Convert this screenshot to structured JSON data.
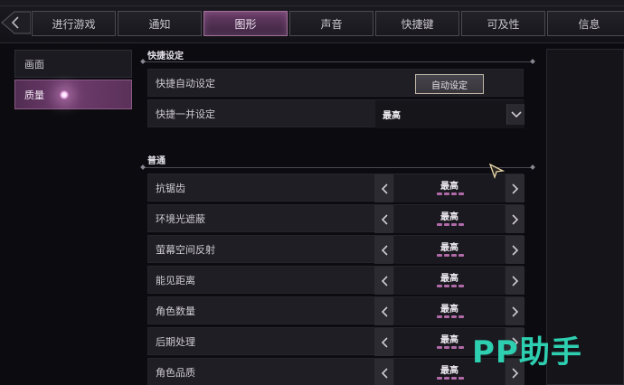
{
  "tabs": [
    {
      "label": "进行游戏",
      "active": false
    },
    {
      "label": "通知",
      "active": false
    },
    {
      "label": "图形",
      "active": true
    },
    {
      "label": "声音",
      "active": false
    },
    {
      "label": "快捷键",
      "active": false
    },
    {
      "label": "可及性",
      "active": false
    },
    {
      "label": "信息",
      "active": false
    }
  ],
  "sidebar": {
    "items": [
      {
        "label": "画面",
        "active": false
      },
      {
        "label": "质量",
        "active": true
      }
    ]
  },
  "quick_settings": {
    "title": "快捷设定",
    "auto_label": "快捷自动设定",
    "auto_button": "自动设定",
    "batch_label": "快捷一并设定",
    "batch_value": "最高"
  },
  "general": {
    "title": "普通",
    "rows": [
      {
        "label": "抗锯齿",
        "value": "最高",
        "level": 4,
        "max": 4
      },
      {
        "label": "环境光遮蔽",
        "value": "最高",
        "level": 4,
        "max": 4
      },
      {
        "label": "萤幕空间反射",
        "value": "最高",
        "level": 4,
        "max": 4
      },
      {
        "label": "能见距离",
        "value": "最高",
        "level": 4,
        "max": 4
      },
      {
        "label": "角色数量",
        "value": "最高",
        "level": 4,
        "max": 4
      },
      {
        "label": "后期处理",
        "value": "最高",
        "level": 4,
        "max": 4
      },
      {
        "label": "角色品质",
        "value": "最高",
        "level": 4,
        "max": 4
      }
    ]
  },
  "watermark": "PP助手",
  "colors": {
    "accent": "#b06aa8",
    "active_tab": "#6a3d68",
    "watermark": "#2ecfb0"
  }
}
